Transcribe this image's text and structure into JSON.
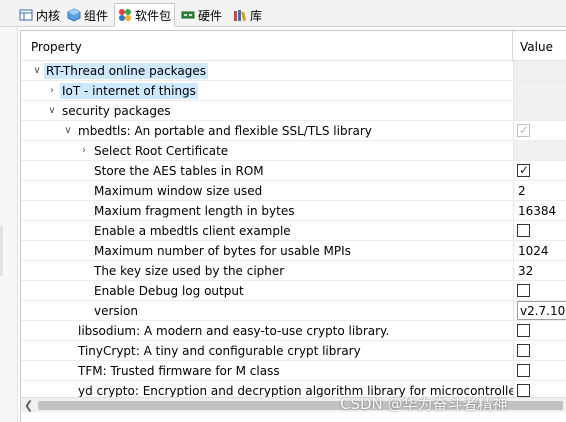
{
  "tabs": [
    {
      "label": "内核",
      "icon": "kernel-icon"
    },
    {
      "label": "组件",
      "icon": "component-cube-icon"
    },
    {
      "label": "软件包",
      "icon": "package-icon"
    },
    {
      "label": "硬件",
      "icon": "hardware-chip-icon"
    },
    {
      "label": "库",
      "icon": "library-books-icon"
    }
  ],
  "active_tab": "软件包",
  "table": {
    "columns": [
      "Property",
      "Value"
    ],
    "rows": [
      {
        "name": "RT-Thread online packages",
        "expander": "expanded",
        "highlight": true
      },
      {
        "name": "IoT - internet of things",
        "expander": "collapsed",
        "highlight": true
      },
      {
        "name": "security packages",
        "expander": "expanded"
      },
      {
        "name": "mbedtls: An portable and flexible SSL/TLS library",
        "expander": "expanded",
        "value_checkbox": "disabled-checked"
      },
      {
        "name": "Select Root Certificate",
        "expander": "collapsed"
      },
      {
        "name": "Store the AES tables in ROM",
        "value_checkbox": "checked"
      },
      {
        "name": "Maximum window size used",
        "value": "2"
      },
      {
        "name": "Maxium fragment length in bytes",
        "value": "16384"
      },
      {
        "name": "Enable a mbedtls client example",
        "value_checkbox": "unchecked"
      },
      {
        "name": "Maximum number of bytes for usable MPIs",
        "value": "1024"
      },
      {
        "name": "The key size used by the cipher",
        "value": "32"
      },
      {
        "name": "Enable Debug log output",
        "value_checkbox": "unchecked"
      },
      {
        "name": "version",
        "value_select": "v2.7.10"
      },
      {
        "name": "libsodium: A modern and easy-to-use crypto library.",
        "value_checkbox": "unchecked"
      },
      {
        "name": "TinyCrypt: A tiny and configurable crypt library",
        "value_checkbox": "unchecked"
      },
      {
        "name": "TFM: Trusted firmware for M class",
        "value_checkbox": "unchecked"
      },
      {
        "name": "yd crypto: Encryption and decryption algorithm library for microcontroller.",
        "value_checkbox": "unchecked"
      }
    ]
  },
  "watermark": "CSDN @华为奋斗者精神",
  "colors": {
    "highlight": "#cde8ff",
    "tab_bar": "#f3f3f3",
    "row_grey": "#f0f0f0"
  }
}
